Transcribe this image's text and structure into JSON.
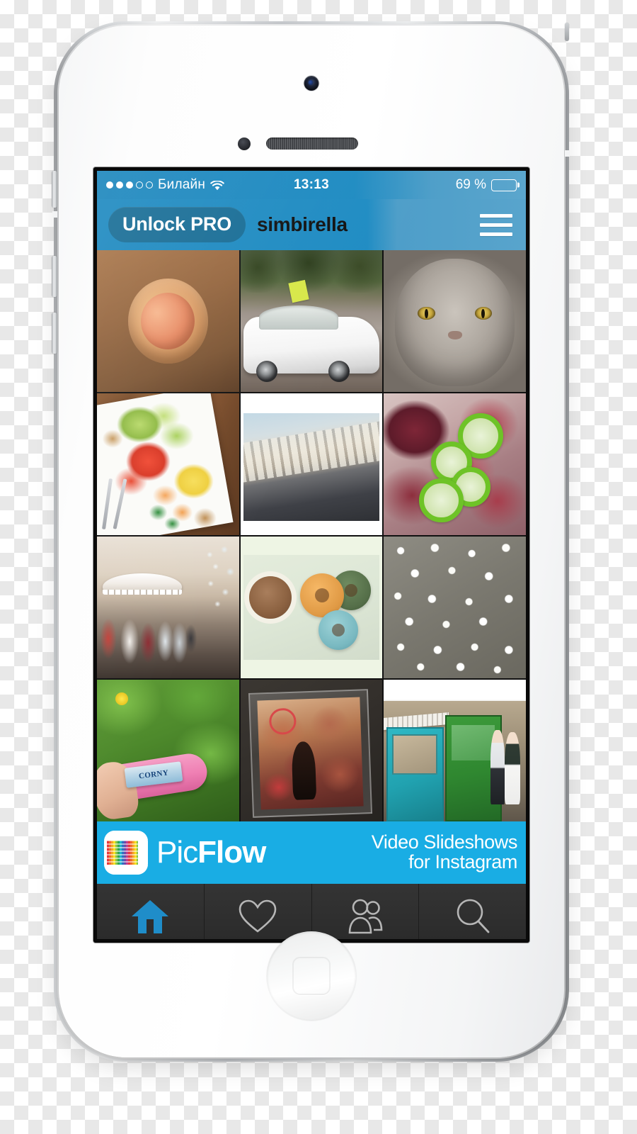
{
  "device": {
    "model": "iphone-white",
    "camera": "front-camera",
    "speaker": "earpiece-speaker",
    "home_button": "home-button"
  },
  "status_bar": {
    "signal_filled": 3,
    "signal_total": 5,
    "carrier": "Билайн",
    "wifi": "wifi-icon",
    "time": "13:13",
    "battery_percent": "69 %",
    "battery_level": 69
  },
  "nav_bar": {
    "unlock_button": "Unlock PRO",
    "title": "simbirella",
    "menu_icon": "hamburger-menu-icon"
  },
  "grid": {
    "tiles": [
      {
        "id": 1,
        "caption": "fruit in a wooden basket"
      },
      {
        "id": 2,
        "caption": "white convertible car with flag"
      },
      {
        "id": 3,
        "caption": "grey persian cat face"
      },
      {
        "id": 4,
        "caption": "fruit platter with grapes and watermelon"
      },
      {
        "id": 5,
        "caption": "tilted city street photo"
      },
      {
        "id": 6,
        "caption": "berries with sliced green jalapenos"
      },
      {
        "id": 7,
        "caption": "indoor market cafe with people"
      },
      {
        "id": 8,
        "caption": "coffee and three donuts"
      },
      {
        "id": 9,
        "caption": "field of small white flowers"
      },
      {
        "id": 10,
        "caption": "hand holding Corny bar on grass"
      },
      {
        "id": 11,
        "caption": "cd case on dark table"
      },
      {
        "id": 12,
        "caption": "couple standing by green and teal doors"
      }
    ],
    "tile10_brand": "CORNY"
  },
  "banner": {
    "logo": "picflow-logo",
    "name_prefix": "Pic",
    "name_suffix": "Flow",
    "tagline_line1": "Video Slideshows",
    "tagline_line2": "for Instagram"
  },
  "tab_bar": {
    "items": [
      {
        "icon": "home-icon",
        "active": true
      },
      {
        "icon": "heart-icon",
        "active": false
      },
      {
        "icon": "people-icon",
        "active": false
      },
      {
        "icon": "search-icon",
        "active": false
      }
    ]
  },
  "colors": {
    "nav_blue": "#1f8cc3",
    "nav_blue_light": "#58a4cc",
    "unlock_pill": "#186d96",
    "banner_cyan": "#19ade4",
    "tab_bar_bg": "#2e2e2e",
    "tab_active": "#1f8dc9",
    "tab_inactive": "#b6b6b6"
  }
}
